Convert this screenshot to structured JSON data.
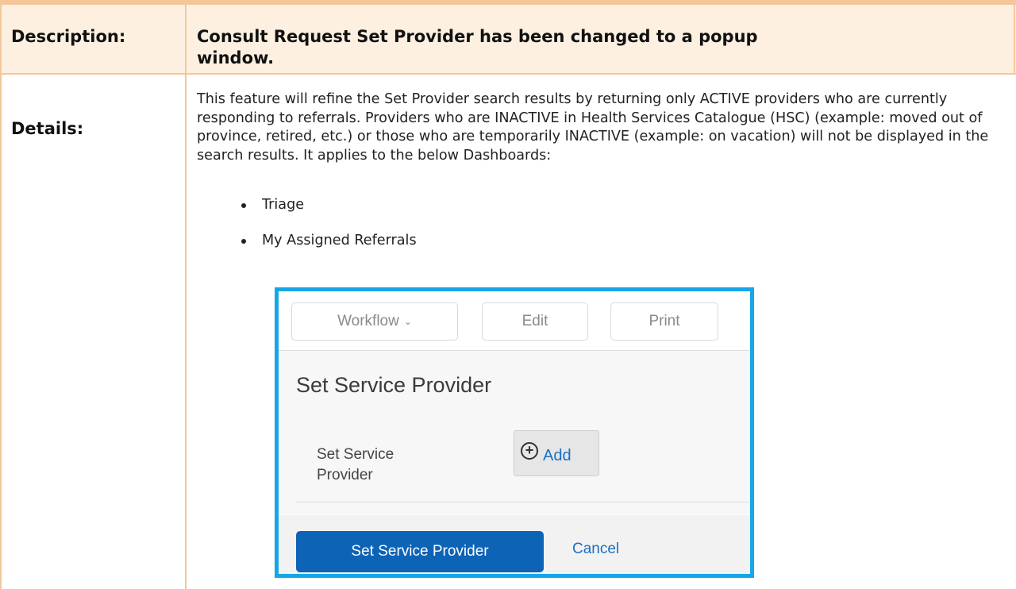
{
  "description": {
    "label": "Description:",
    "text": "Consult Request Set Provider has been changed to a popup window."
  },
  "details": {
    "label": "Details:",
    "paragraph": "This feature will refine the Set Provider search results by returning only ACTIVE providers who are currently responding to referrals. Providers who are INACTIVE in Health Services Catalogue (HSC) (example: moved out of province, retired, etc.) or those who are temporarily INACTIVE (example: on vacation) will not be displayed in the search results. It applies to the below Dashboards:",
    "bullets": [
      "Triage",
      "My Assigned Referrals"
    ]
  },
  "screenshot": {
    "toolbar": {
      "workflow_label": "Workflow",
      "edit_label": "Edit",
      "print_label": "Print"
    },
    "panel_title": "Set Service Provider",
    "field_label": "Set Service Provider",
    "add_label": "Add",
    "primary_label": "Set Service Provider",
    "cancel_label": "Cancel",
    "accent_color": "#16a6e6",
    "primary_color": "#0d63b5"
  },
  "theme": {
    "table_border_color": "#f3c79a",
    "header_row_bg": "#fdf0e1"
  }
}
